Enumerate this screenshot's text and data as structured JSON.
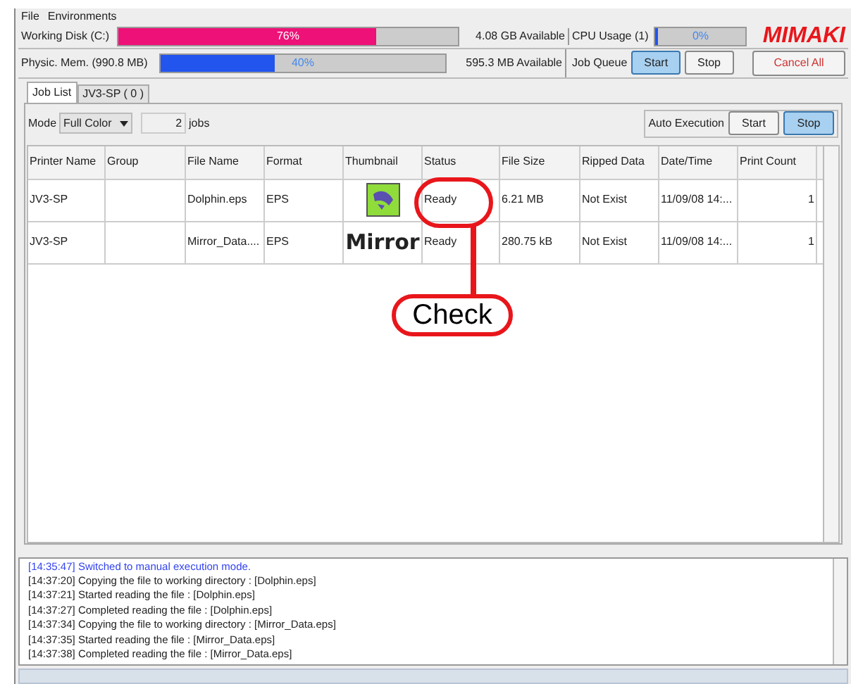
{
  "menu": [
    "File",
    "Environments"
  ],
  "meters": [
    {
      "label": "Working Disk (C:)",
      "level": 0.76,
      "reading": "76%",
      "available": "4.08 GB Available",
      "color": "#ee1177"
    },
    {
      "label": "Physic. Mem. (990.8 MB)",
      "level": 0.4,
      "reading": "40%",
      "available": "595.3 MB Available",
      "color": "#2255ee"
    }
  ],
  "cpu": {
    "label": "CPU Usage (1)",
    "level": 0.0,
    "reading": "0%"
  },
  "logo": "MIMAKI",
  "job_queue": {
    "label": "Job Queue",
    "buttons": [
      {
        "label": "Start",
        "selected": true
      },
      {
        "label": "Stop",
        "selected": false
      }
    ]
  },
  "cancel_all": "Cancel All",
  "tabs": [
    {
      "label": "Job List",
      "selected": true
    },
    {
      "label": "JV3-SP ( 0 )",
      "selected": false
    }
  ],
  "mode": {
    "label": "Mode",
    "value": "Full Color",
    "count": "2",
    "unit": "jobs"
  },
  "auto_execution": {
    "label": "Auto Execution",
    "buttons": [
      {
        "label": "Start",
        "selected": false
      },
      {
        "label": "Stop",
        "selected": true
      }
    ]
  },
  "table": {
    "columns": [
      "Printer Name",
      "Group",
      "File Name",
      "Format",
      "Thumbnail",
      "Status",
      "File Size",
      "Ripped Data",
      "Date/Time",
      "Print Count"
    ],
    "rows": [
      {
        "printer": "JV3-SP",
        "file": "Dolphin.eps",
        "format": "EPS",
        "status": "Ready",
        "size": "6.21 MB",
        "ripped": "Not Exist",
        "date": "11/09/08 14:...",
        "count": "1"
      },
      {
        "printer": "JV3-SP",
        "file": "Mirror_Data....",
        "format": "EPS",
        "thumbnail": "Mirror",
        "status": "Ready",
        "size": "280.75 kB",
        "ripped": "Not Exist",
        "date": "11/09/08 14:...",
        "count": "1"
      }
    ]
  },
  "log": [
    {
      "text": "[14:35:47] Switched to manual execution mode.",
      "kind": "info"
    },
    {
      "text": "[14:37:20] Copying the file to working directory : [Dolphin.eps]",
      "kind": "normal"
    },
    {
      "text": "[14:37:21] Started reading the file : [Dolphin.eps]",
      "kind": "normal"
    },
    {
      "text": "[14:37:27] Completed reading the file : [Dolphin.eps]",
      "kind": "normal"
    },
    {
      "text": "[14:37:34] Copying the file to working directory : [Mirror_Data.eps]",
      "kind": "normal"
    },
    {
      "text": "[14:37:35] Started reading the file : [Mirror_Data.eps]",
      "kind": "normal"
    },
    {
      "text": "[14:37:38] Completed reading the file : [Mirror_Data.eps]",
      "kind": "normal"
    }
  ],
  "callout": "Check"
}
